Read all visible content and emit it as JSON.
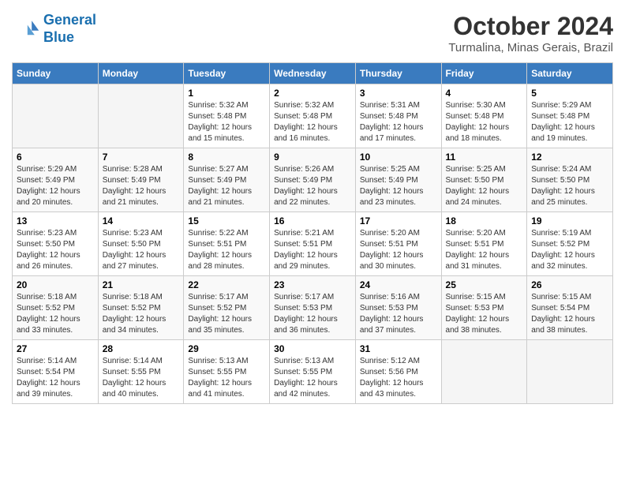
{
  "logo": {
    "line1": "General",
    "line2": "Blue"
  },
  "header": {
    "month": "October 2024",
    "location": "Turmalina, Minas Gerais, Brazil"
  },
  "weekdays": [
    "Sunday",
    "Monday",
    "Tuesday",
    "Wednesday",
    "Thursday",
    "Friday",
    "Saturday"
  ],
  "weeks": [
    [
      {
        "day": "",
        "sunrise": "",
        "sunset": "",
        "daylight": ""
      },
      {
        "day": "",
        "sunrise": "",
        "sunset": "",
        "daylight": ""
      },
      {
        "day": "1",
        "sunrise": "Sunrise: 5:32 AM",
        "sunset": "Sunset: 5:48 PM",
        "daylight": "Daylight: 12 hours and 15 minutes."
      },
      {
        "day": "2",
        "sunrise": "Sunrise: 5:32 AM",
        "sunset": "Sunset: 5:48 PM",
        "daylight": "Daylight: 12 hours and 16 minutes."
      },
      {
        "day": "3",
        "sunrise": "Sunrise: 5:31 AM",
        "sunset": "Sunset: 5:48 PM",
        "daylight": "Daylight: 12 hours and 17 minutes."
      },
      {
        "day": "4",
        "sunrise": "Sunrise: 5:30 AM",
        "sunset": "Sunset: 5:48 PM",
        "daylight": "Daylight: 12 hours and 18 minutes."
      },
      {
        "day": "5",
        "sunrise": "Sunrise: 5:29 AM",
        "sunset": "Sunset: 5:48 PM",
        "daylight": "Daylight: 12 hours and 19 minutes."
      }
    ],
    [
      {
        "day": "6",
        "sunrise": "Sunrise: 5:29 AM",
        "sunset": "Sunset: 5:49 PM",
        "daylight": "Daylight: 12 hours and 20 minutes."
      },
      {
        "day": "7",
        "sunrise": "Sunrise: 5:28 AM",
        "sunset": "Sunset: 5:49 PM",
        "daylight": "Daylight: 12 hours and 21 minutes."
      },
      {
        "day": "8",
        "sunrise": "Sunrise: 5:27 AM",
        "sunset": "Sunset: 5:49 PM",
        "daylight": "Daylight: 12 hours and 21 minutes."
      },
      {
        "day": "9",
        "sunrise": "Sunrise: 5:26 AM",
        "sunset": "Sunset: 5:49 PM",
        "daylight": "Daylight: 12 hours and 22 minutes."
      },
      {
        "day": "10",
        "sunrise": "Sunrise: 5:25 AM",
        "sunset": "Sunset: 5:49 PM",
        "daylight": "Daylight: 12 hours and 23 minutes."
      },
      {
        "day": "11",
        "sunrise": "Sunrise: 5:25 AM",
        "sunset": "Sunset: 5:50 PM",
        "daylight": "Daylight: 12 hours and 24 minutes."
      },
      {
        "day": "12",
        "sunrise": "Sunrise: 5:24 AM",
        "sunset": "Sunset: 5:50 PM",
        "daylight": "Daylight: 12 hours and 25 minutes."
      }
    ],
    [
      {
        "day": "13",
        "sunrise": "Sunrise: 5:23 AM",
        "sunset": "Sunset: 5:50 PM",
        "daylight": "Daylight: 12 hours and 26 minutes."
      },
      {
        "day": "14",
        "sunrise": "Sunrise: 5:23 AM",
        "sunset": "Sunset: 5:50 PM",
        "daylight": "Daylight: 12 hours and 27 minutes."
      },
      {
        "day": "15",
        "sunrise": "Sunrise: 5:22 AM",
        "sunset": "Sunset: 5:51 PM",
        "daylight": "Daylight: 12 hours and 28 minutes."
      },
      {
        "day": "16",
        "sunrise": "Sunrise: 5:21 AM",
        "sunset": "Sunset: 5:51 PM",
        "daylight": "Daylight: 12 hours and 29 minutes."
      },
      {
        "day": "17",
        "sunrise": "Sunrise: 5:20 AM",
        "sunset": "Sunset: 5:51 PM",
        "daylight": "Daylight: 12 hours and 30 minutes."
      },
      {
        "day": "18",
        "sunrise": "Sunrise: 5:20 AM",
        "sunset": "Sunset: 5:51 PM",
        "daylight": "Daylight: 12 hours and 31 minutes."
      },
      {
        "day": "19",
        "sunrise": "Sunrise: 5:19 AM",
        "sunset": "Sunset: 5:52 PM",
        "daylight": "Daylight: 12 hours and 32 minutes."
      }
    ],
    [
      {
        "day": "20",
        "sunrise": "Sunrise: 5:18 AM",
        "sunset": "Sunset: 5:52 PM",
        "daylight": "Daylight: 12 hours and 33 minutes."
      },
      {
        "day": "21",
        "sunrise": "Sunrise: 5:18 AM",
        "sunset": "Sunset: 5:52 PM",
        "daylight": "Daylight: 12 hours and 34 minutes."
      },
      {
        "day": "22",
        "sunrise": "Sunrise: 5:17 AM",
        "sunset": "Sunset: 5:52 PM",
        "daylight": "Daylight: 12 hours and 35 minutes."
      },
      {
        "day": "23",
        "sunrise": "Sunrise: 5:17 AM",
        "sunset": "Sunset: 5:53 PM",
        "daylight": "Daylight: 12 hours and 36 minutes."
      },
      {
        "day": "24",
        "sunrise": "Sunrise: 5:16 AM",
        "sunset": "Sunset: 5:53 PM",
        "daylight": "Daylight: 12 hours and 37 minutes."
      },
      {
        "day": "25",
        "sunrise": "Sunrise: 5:15 AM",
        "sunset": "Sunset: 5:53 PM",
        "daylight": "Daylight: 12 hours and 38 minutes."
      },
      {
        "day": "26",
        "sunrise": "Sunrise: 5:15 AM",
        "sunset": "Sunset: 5:54 PM",
        "daylight": "Daylight: 12 hours and 38 minutes."
      }
    ],
    [
      {
        "day": "27",
        "sunrise": "Sunrise: 5:14 AM",
        "sunset": "Sunset: 5:54 PM",
        "daylight": "Daylight: 12 hours and 39 minutes."
      },
      {
        "day": "28",
        "sunrise": "Sunrise: 5:14 AM",
        "sunset": "Sunset: 5:55 PM",
        "daylight": "Daylight: 12 hours and 40 minutes."
      },
      {
        "day": "29",
        "sunrise": "Sunrise: 5:13 AM",
        "sunset": "Sunset: 5:55 PM",
        "daylight": "Daylight: 12 hours and 41 minutes."
      },
      {
        "day": "30",
        "sunrise": "Sunrise: 5:13 AM",
        "sunset": "Sunset: 5:55 PM",
        "daylight": "Daylight: 12 hours and 42 minutes."
      },
      {
        "day": "31",
        "sunrise": "Sunrise: 5:12 AM",
        "sunset": "Sunset: 5:56 PM",
        "daylight": "Daylight: 12 hours and 43 minutes."
      },
      {
        "day": "",
        "sunrise": "",
        "sunset": "",
        "daylight": ""
      },
      {
        "day": "",
        "sunrise": "",
        "sunset": "",
        "daylight": ""
      }
    ]
  ]
}
